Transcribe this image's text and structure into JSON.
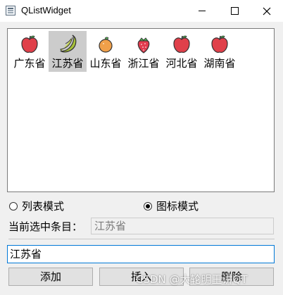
{
  "window": {
    "title": "QListWidget"
  },
  "list": {
    "items": [
      {
        "label": "广东省",
        "icon": "apple-icon",
        "selected": false
      },
      {
        "label": "江苏省",
        "icon": "banana-icon",
        "selected": true
      },
      {
        "label": "山东省",
        "icon": "orange-icon",
        "selected": false
      },
      {
        "label": "浙江省",
        "icon": "strawberry-icon",
        "selected": false
      },
      {
        "label": "河北省",
        "icon": "apple-icon",
        "selected": false
      },
      {
        "label": "湖南省",
        "icon": "apple-icon",
        "selected": false
      }
    ]
  },
  "view_mode": {
    "list_mode_label": "列表模式",
    "icon_mode_label": "图标模式",
    "selected": "icon"
  },
  "current": {
    "label": "当前选中条目：",
    "value": "江苏省"
  },
  "edit": {
    "value": "江苏省"
  },
  "buttons": {
    "add": "添加",
    "insert": "插入",
    "delete": "删除"
  },
  "watermark": "CSDN @大轮明王讲QT",
  "colors": {
    "selection": "#cccccc",
    "focus_border": "#0078d7",
    "apple": "#e0404a",
    "banana": "#a8c23a",
    "orange": "#f0a04a",
    "strawberry": "#e23b4e"
  }
}
